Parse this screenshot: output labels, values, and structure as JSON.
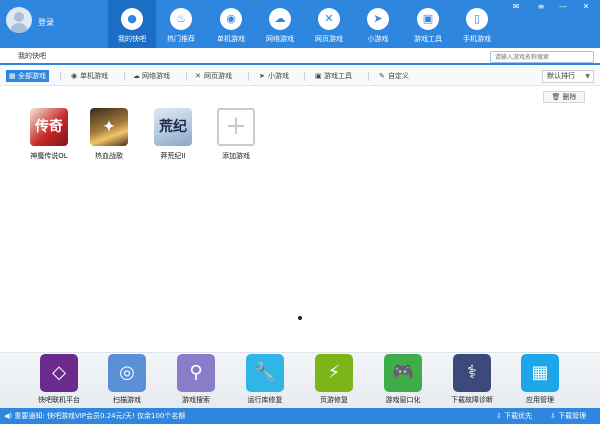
{
  "header": {
    "login_label": "登录",
    "nav": [
      {
        "label": "我的快吧",
        "icon": "user-icon",
        "glyph": "●"
      },
      {
        "label": "热门推荐",
        "icon": "flame-icon",
        "glyph": "♨"
      },
      {
        "label": "单机游戏",
        "icon": "gamepad-icon",
        "glyph": "◉"
      },
      {
        "label": "网络游戏",
        "icon": "cloud-icon",
        "glyph": "☁"
      },
      {
        "label": "网页游戏",
        "icon": "crossed-swords-icon",
        "glyph": "✕"
      },
      {
        "label": "小游戏",
        "icon": "paper-plane-icon",
        "glyph": "➤"
      },
      {
        "label": "游戏工具",
        "icon": "toolbox-icon",
        "glyph": "▣"
      },
      {
        "label": "手机游戏",
        "icon": "phone-icon",
        "glyph": "▯"
      }
    ],
    "window_controls": [
      {
        "icon": "mail-icon",
        "glyph": "✉"
      },
      {
        "icon": "menu-icon",
        "glyph": "≡"
      },
      {
        "icon": "minimize-icon",
        "glyph": "—"
      },
      {
        "icon": "close-icon",
        "glyph": "✕"
      }
    ]
  },
  "search": {
    "placeholder": "请输入游戏名称搜索"
  },
  "my_tab": {
    "label": "我的快吧"
  },
  "categories": [
    {
      "label": "全部游戏",
      "icon": "grid-icon",
      "glyph": "▦"
    },
    {
      "label": "单机游戏",
      "icon": "gamepad-icon",
      "glyph": "◉"
    },
    {
      "label": "网络游戏",
      "icon": "cloud-icon",
      "glyph": "☁"
    },
    {
      "label": "网页游戏",
      "icon": "crossed-swords-icon",
      "glyph": "✕"
    },
    {
      "label": "小游戏",
      "icon": "paper-plane-icon",
      "glyph": "➤"
    },
    {
      "label": "游戏工具",
      "icon": "toolbox-icon",
      "glyph": "▣"
    },
    {
      "label": "自定义",
      "icon": "pencil-icon",
      "glyph": "✎"
    }
  ],
  "sort": {
    "selected": "默认排行",
    "arrow": "▼"
  },
  "delete_button": {
    "label": "删除",
    "glyph": "🗑"
  },
  "games": [
    {
      "label": "神魔传说OL",
      "thumb_text": "传奇"
    },
    {
      "label": "热血战歌",
      "thumb_text": "✦"
    },
    {
      "label": "莽荒纪II",
      "thumb_text": "荒纪"
    }
  ],
  "add_game": {
    "label": "添加游戏",
    "glyph": "+"
  },
  "tools": [
    {
      "label": "快吧联机平台",
      "icon": "link-icon",
      "glyph": "◇",
      "color": "#6a2b8c"
    },
    {
      "label": "扫描游戏",
      "icon": "radar-icon",
      "glyph": "◎",
      "color": "#5b8fd6"
    },
    {
      "label": "游戏搜索",
      "icon": "magnifier-icon",
      "glyph": "⚲",
      "color": "#8a7cc8"
    },
    {
      "label": "运行库修复",
      "icon": "wrench-icon",
      "glyph": "🔧",
      "color": "#2fb6e6"
    },
    {
      "label": "页游修复",
      "icon": "lightning-icon",
      "glyph": "⚡",
      "color": "#7cb518"
    },
    {
      "label": "游戏窗口化",
      "icon": "gamepad-window-icon",
      "glyph": "🎮",
      "color": "#3fae49"
    },
    {
      "label": "下载故障诊断",
      "icon": "stethoscope-icon",
      "glyph": "⚕",
      "color": "#3b4a7a"
    },
    {
      "label": "应用管理",
      "icon": "apps-grid-icon",
      "glyph": "▦",
      "color": "#1ea7e8"
    }
  ],
  "statusbar": {
    "notice": "重要通知: 快吧游戏VIP会员0.24元/天! 仅余100个名额",
    "download_priority": "下载优先",
    "download_manager": "下载管理"
  }
}
